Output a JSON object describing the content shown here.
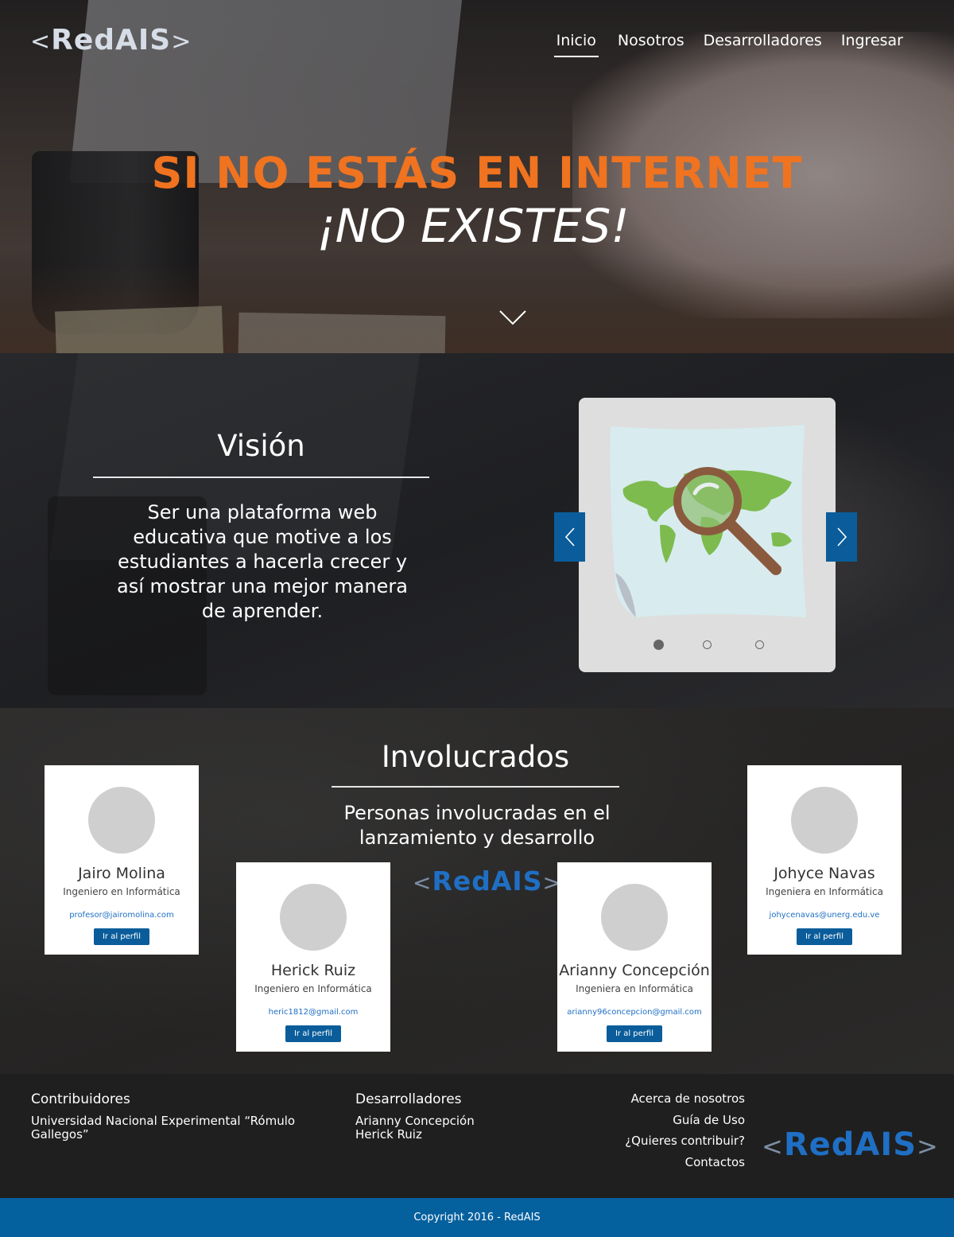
{
  "header": {
    "logo": {
      "left": "<",
      "text": "RedAIS",
      "right": ">"
    },
    "nav": [
      {
        "label": "Inicio",
        "active": true
      },
      {
        "label": "Nosotros"
      },
      {
        "label": "Desarrolladores"
      },
      {
        "label": "Ingresar"
      }
    ]
  },
  "hero": {
    "headline": "SI NO ESTÁS EN INTERNET",
    "subline": "¡NO  EXISTES!",
    "scroll_icon": "chevron-down-icon"
  },
  "vision": {
    "title": "Visión",
    "text": "Ser una plataforma web educativa que motive a los estudiantes a hacerla crecer y así mostrar una mejor manera de aprender.",
    "carousel": {
      "slides": 3,
      "active_slide": 1,
      "prev_icon": "chevron-left-icon",
      "next_icon": "chevron-right-icon"
    }
  },
  "involved": {
    "title": "Involucrados",
    "text": "Personas involucradas en el lanzamiento y desarrollo",
    "logo": {
      "left": "<",
      "text": "RedAIS",
      "right": ">"
    },
    "people": [
      {
        "name": "Jairo Molina",
        "role": "Ingeniero en Informática",
        "email": "profesor@jairomolina.com",
        "button": "Ir al perfil"
      },
      {
        "name": "Herick Ruiz",
        "role": "Ingeniero en Informática",
        "email": "heric1812@gmail.com",
        "button": "Ir al perfil"
      },
      {
        "name": "Arianny Concepción",
        "role": "Ingeniera en Informática",
        "email": "arianny96concepcion@gmail.com",
        "button": "Ir al perfil"
      },
      {
        "name": "Johyce Navas",
        "role": "Ingeniera en Informática",
        "email": "johycenavas@unerg.edu.ve",
        "button": "Ir al perfil"
      }
    ]
  },
  "footer": {
    "contributors": {
      "title": "Contribuidores",
      "text": "Universidad Nacional Experimental “Rómulo Gallegos”"
    },
    "developers": {
      "title": "Desarrolladores",
      "names": [
        "Arianny Concepción",
        "Herick Ruiz"
      ]
    },
    "links": [
      "Acerca de nosotros",
      "Guía de Uso",
      "¿Quieres contribuir?",
      "Contactos"
    ],
    "logo": {
      "left": "<",
      "text": "RedAIS",
      "right": ">"
    },
    "copyright": "Copyright 2016 - RedAIS"
  },
  "colors": {
    "accent_orange": "#f07320",
    "brand_blue": "#0a5d9a",
    "logo_blue": "#1f6fc4"
  }
}
